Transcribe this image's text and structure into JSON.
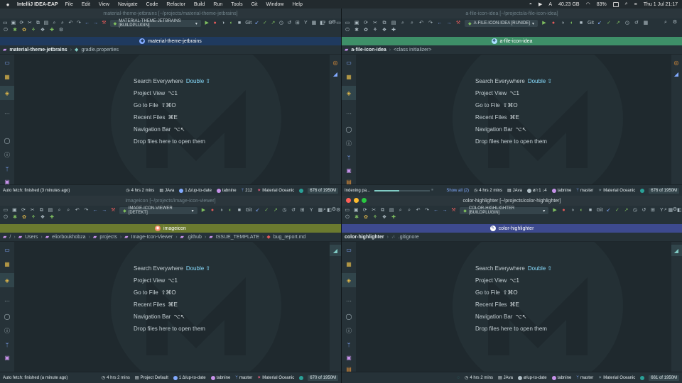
{
  "menubar": {
    "app_name": "IntelliJ IDEA-EAP",
    "items": [
      "File",
      "Edit",
      "View",
      "Navigate",
      "Code",
      "Refactor",
      "Build",
      "Run",
      "Tools",
      "Git",
      "Window",
      "Help"
    ],
    "memory": "40.23 GB",
    "battery": "83%",
    "datetime": "Thu 1 Jul  21:17",
    "icons": [
      "apple-icon",
      "shield-icon",
      "play-icon",
      "text-icon",
      "wifi-icon",
      "battery-icon",
      "search-icon",
      "control-center-icon"
    ]
  },
  "hints": {
    "search_everywhere": "Search Everywhere",
    "search_everywhere_sc": "Double ⇧",
    "project_view": "Project View",
    "project_view_sc": "⌥1",
    "go_to_file": "Go to File",
    "go_to_file_sc": "⇧⌘O",
    "recent_files": "Recent Files",
    "recent_files_sc": "⌘E",
    "navigation_bar": "Navigation Bar",
    "navigation_bar_sc": "⌥↖",
    "drop_files": "Drop files here to open them"
  },
  "panes": {
    "tl": {
      "title": "material-theme-jetbrains [~/projects/material-theme-jetbrains]",
      "run_config": "MATERIAL-THEME-JETBRAINS [BUILDPLUGIN]",
      "banner": "material-theme-jetbrains",
      "banner_color": "#1f3a5f",
      "nav": [
        "material-theme-jetbrains",
        "gradle.properties"
      ],
      "status_left": "Auto fetch: finished (3 minutes ago)",
      "time": "4 hrs 2 mins",
      "sdk": "JAva",
      "vcs": "1 Δ/up-to-date",
      "tabnine": "tabnine",
      "branch": "212",
      "theme": "Material Oceanic",
      "memory": "676 of 1950M"
    },
    "tr": {
      "title": "a-file-icon-idea [~/projects/a-file-icon-idea]",
      "run_config": "A-FILE-ICON-IDEA [RUNIDE]",
      "banner": "a-file-icon-idea",
      "banner_color": "#3e8f68",
      "nav": [
        "a-file-icon-idea",
        "<class initializer>"
      ],
      "status_left": "Indexing pa...",
      "progress": 0.45,
      "show_all": "Show all (2)",
      "time": "4 hrs 2 mins",
      "sdk": "JAva",
      "vcs": "ø/↑1 ↓4",
      "tabnine": "tabnine",
      "branch": "master",
      "theme": "Material Oceanic",
      "memory": "676 of 1950M"
    },
    "bl": {
      "title": "imageicon [~/projects/image-icon-viewer]",
      "run_config": "IMAGE-ICON-VIEWER [DETEKT]",
      "banner": "imageicon",
      "banner_color": "#6b7a2f",
      "nav": [
        "/",
        "Users",
        "eliorboukhobza",
        "projects",
        "Image-Icon-Viewer",
        ".github",
        "ISSUE_TEMPLATE",
        "bug_report.md"
      ],
      "status_left": "Auto fetch: finished (a minute ago)",
      "time": "4 hrs 2 mins",
      "sdk": "Project Default",
      "vcs": "1 Δ/up-to-date",
      "tabnine": "tabnine",
      "branch": "master",
      "theme": "Material Oceanic",
      "memory": "670 of 1950M"
    },
    "br": {
      "title": "color-highlighter [~/projects/color-highlighter]",
      "run_config": "COLOR-HIGHLIGHTER [BUILDPLUGIN]",
      "banner": "color-highlighter",
      "banner_color": "#3d4a8f",
      "nav": [
        "color-highlighter",
        ".gitignore"
      ],
      "status_left": "",
      "time": "4 hrs 2 mins",
      "sdk": "JAva",
      "vcs": "ø/up-to-date",
      "tabnine": "tabnine",
      "branch": "master",
      "theme": "Material Oceanic",
      "memory": "661 of 1950M"
    }
  }
}
